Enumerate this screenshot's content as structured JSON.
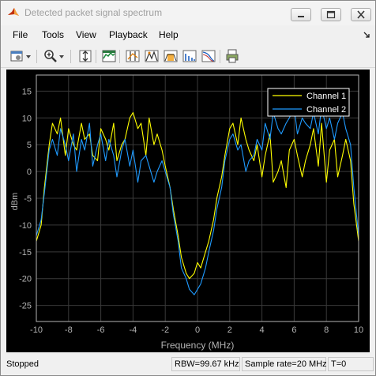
{
  "window": {
    "title": "Detected packet signal spectrum"
  },
  "menu": {
    "items": [
      "File",
      "Tools",
      "View",
      "Playback",
      "Help"
    ]
  },
  "toolbar": {
    "icons": [
      "configuration-properties-icon",
      "dropdown-arrow-icon",
      "zoom-in-icon",
      "dropdown-arrow-icon",
      "autoscale-icon",
      "spectrum-settings-icon",
      "data-cursors-icon",
      "peak-finder-icon",
      "channel-measurements-icon",
      "distortion-measurements-icon",
      "ccdf-measurements-icon",
      "print-icon"
    ]
  },
  "status": {
    "state": "Stopped",
    "rbw": "RBW=99.67 kHz",
    "sample_rate": "Sample rate=20 MHz",
    "time": "T=0"
  },
  "colors": {
    "channel1": "#ffff00",
    "channel2": "#1f9bff",
    "background": "#000000",
    "axes": "#b4b4b4"
  },
  "chart_data": {
    "type": "line",
    "xlabel": "Frequency (MHz)",
    "ylabel": "dBm",
    "xlim": [
      -10,
      10
    ],
    "ylim": [
      -28,
      18
    ],
    "xticks": [
      "-10",
      "-8",
      "-6",
      "-4",
      "-2",
      "0",
      "2",
      "4",
      "6",
      "8",
      "10"
    ],
    "yticks": [
      "15",
      "10",
      "5",
      "0",
      "-5",
      "-10",
      "-15",
      "-20",
      "-25"
    ],
    "grid": true,
    "legend": "top-right",
    "series": [
      {
        "name": "Channel 1",
        "color": "#ffff00",
        "x": [
          -10,
          -9.7,
          -9.5,
          -9.2,
          -9,
          -8.7,
          -8.5,
          -8.2,
          -8,
          -7.7,
          -7.5,
          -7.2,
          -7,
          -6.7,
          -6.5,
          -6.2,
          -6,
          -5.7,
          -5.5,
          -5.2,
          -5,
          -4.7,
          -4.5,
          -4.2,
          -4,
          -3.7,
          -3.5,
          -3.2,
          -3,
          -2.7,
          -2.5,
          -2.2,
          -2,
          -1.7,
          -1.5,
          -1.2,
          -1,
          -0.7,
          -0.5,
          -0.2,
          0,
          0.2,
          0.5,
          0.7,
          1,
          1.2,
          1.5,
          1.7,
          2,
          2.2,
          2.5,
          2.7,
          3,
          3.2,
          3.5,
          3.7,
          4,
          4.2,
          4.5,
          4.7,
          5,
          5.2,
          5.5,
          5.7,
          6,
          6.2,
          6.5,
          6.7,
          7,
          7.2,
          7.5,
          7.7,
          8,
          8.2,
          8.5,
          8.7,
          9,
          9.2,
          9.5,
          9.7,
          10
        ],
        "y": [
          -13,
          -10,
          -3,
          5,
          9,
          7,
          10,
          3,
          8,
          5,
          4,
          9,
          6,
          7,
          3,
          2,
          8,
          6,
          4,
          9,
          2,
          5,
          6,
          10,
          11,
          8,
          9,
          3,
          10,
          5,
          7,
          4,
          1,
          -3,
          -7,
          -12,
          -16,
          -19,
          -20,
          -19,
          -17,
          -18,
          -15,
          -13,
          -9,
          -5,
          -1,
          3,
          8,
          9,
          5,
          10,
          6,
          4,
          2,
          5,
          -1,
          3,
          7,
          -2,
          0,
          2,
          -3,
          4,
          6,
          3,
          -1,
          2,
          5,
          8,
          1,
          9,
          -2,
          4,
          6,
          -1,
          3,
          6,
          2,
          -6,
          -13
        ]
      },
      {
        "name": "Channel 2",
        "color": "#1f9bff",
        "x": [
          -10,
          -9.7,
          -9.5,
          -9.2,
          -9,
          -8.7,
          -8.5,
          -8.2,
          -8,
          -7.7,
          -7.5,
          -7.2,
          -7,
          -6.7,
          -6.5,
          -6.2,
          -6,
          -5.7,
          -5.5,
          -5.2,
          -5,
          -4.7,
          -4.5,
          -4.2,
          -4,
          -3.7,
          -3.5,
          -3.2,
          -3,
          -2.7,
          -2.5,
          -2.2,
          -2,
          -1.7,
          -1.5,
          -1.2,
          -1,
          -0.7,
          -0.5,
          -0.2,
          0,
          0.2,
          0.5,
          0.7,
          1,
          1.2,
          1.5,
          1.7,
          2,
          2.2,
          2.5,
          2.7,
          3,
          3.2,
          3.5,
          3.7,
          4,
          4.2,
          4.5,
          4.7,
          5,
          5.2,
          5.5,
          5.7,
          6,
          6.2,
          6.5,
          6.7,
          7,
          7.2,
          7.5,
          7.7,
          8,
          8.2,
          8.5,
          8.7,
          9,
          9.2,
          9.5,
          9.7,
          10
        ],
        "y": [
          -12,
          -9,
          -4,
          4,
          6,
          3,
          8,
          5,
          2,
          7,
          0,
          6,
          4,
          9,
          1,
          5,
          7,
          2,
          6,
          3,
          -1,
          4,
          6,
          1,
          4,
          -2,
          2,
          3,
          1,
          -2,
          0,
          2,
          0,
          -3,
          -8,
          -13,
          -18,
          -20,
          -22,
          -23,
          -22,
          -21,
          -18,
          -15,
          -11,
          -7,
          -3,
          2,
          6,
          7,
          4,
          5,
          0,
          2,
          3,
          6,
          4,
          9,
          6,
          11,
          8,
          7,
          9,
          10,
          12,
          7,
          10,
          9,
          8,
          11,
          7,
          12,
          8,
          10,
          6,
          9,
          11,
          8,
          5,
          -3,
          -12
        ]
      }
    ]
  }
}
